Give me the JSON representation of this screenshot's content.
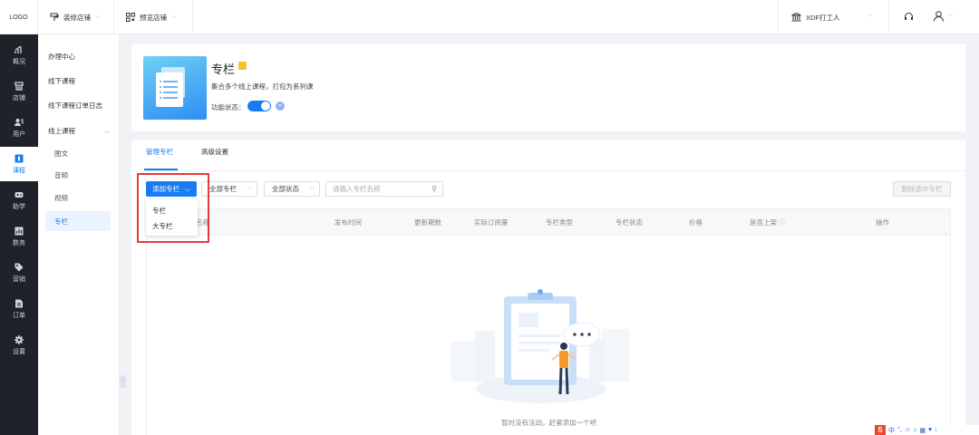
{
  "topbar": {
    "logo": "LOGO",
    "decorate_store": "装修店铺",
    "preview_store": "预览店铺",
    "org_name": "XDF打工人"
  },
  "rail": [
    {
      "label": "概况",
      "icon": "chart-icon"
    },
    {
      "label": "店铺",
      "icon": "store-icon"
    },
    {
      "label": "用户",
      "icon": "users-icon"
    },
    {
      "label": "课程",
      "icon": "course-icon",
      "active": true
    },
    {
      "label": "助学",
      "icon": "gamepad-icon"
    },
    {
      "label": "数务",
      "icon": "data-icon"
    },
    {
      "label": "营销",
      "icon": "tag-icon"
    },
    {
      "label": "订单",
      "icon": "order-icon"
    },
    {
      "label": "设置",
      "icon": "gear-icon"
    }
  ],
  "subnav": {
    "items": [
      "办理中心",
      "线下课程",
      "线下课程订单日志",
      "线上课程"
    ],
    "children": [
      "图文",
      "音频",
      "视频",
      "专栏"
    ]
  },
  "hero": {
    "title": "专栏",
    "desc": "集合多个线上课程，打包为系列课",
    "status_label": "功能状态：",
    "status_on": true
  },
  "tabs": [
    "管理专栏",
    "高级设置"
  ],
  "toolbar": {
    "add_button": "添加专栏",
    "filter_type": "全部专栏",
    "filter_status": "全部状态",
    "search_placeholder": "请输入专栏名称",
    "delete_button": "删除选中专栏"
  },
  "dropdown": [
    "专栏",
    "大专栏"
  ],
  "table": {
    "columns": [
      "专栏名称",
      "发布时间",
      "更新期数",
      "实际订阅量",
      "专栏类型",
      "专栏状态",
      "价格",
      "是否上架",
      "操作"
    ]
  },
  "empty_text": "暂时没有活动，赶紧添加一个吧",
  "colors": {
    "accent": "#1a7cf3",
    "rail_bg": "#1f2329",
    "highlight": "#e83a3a"
  }
}
